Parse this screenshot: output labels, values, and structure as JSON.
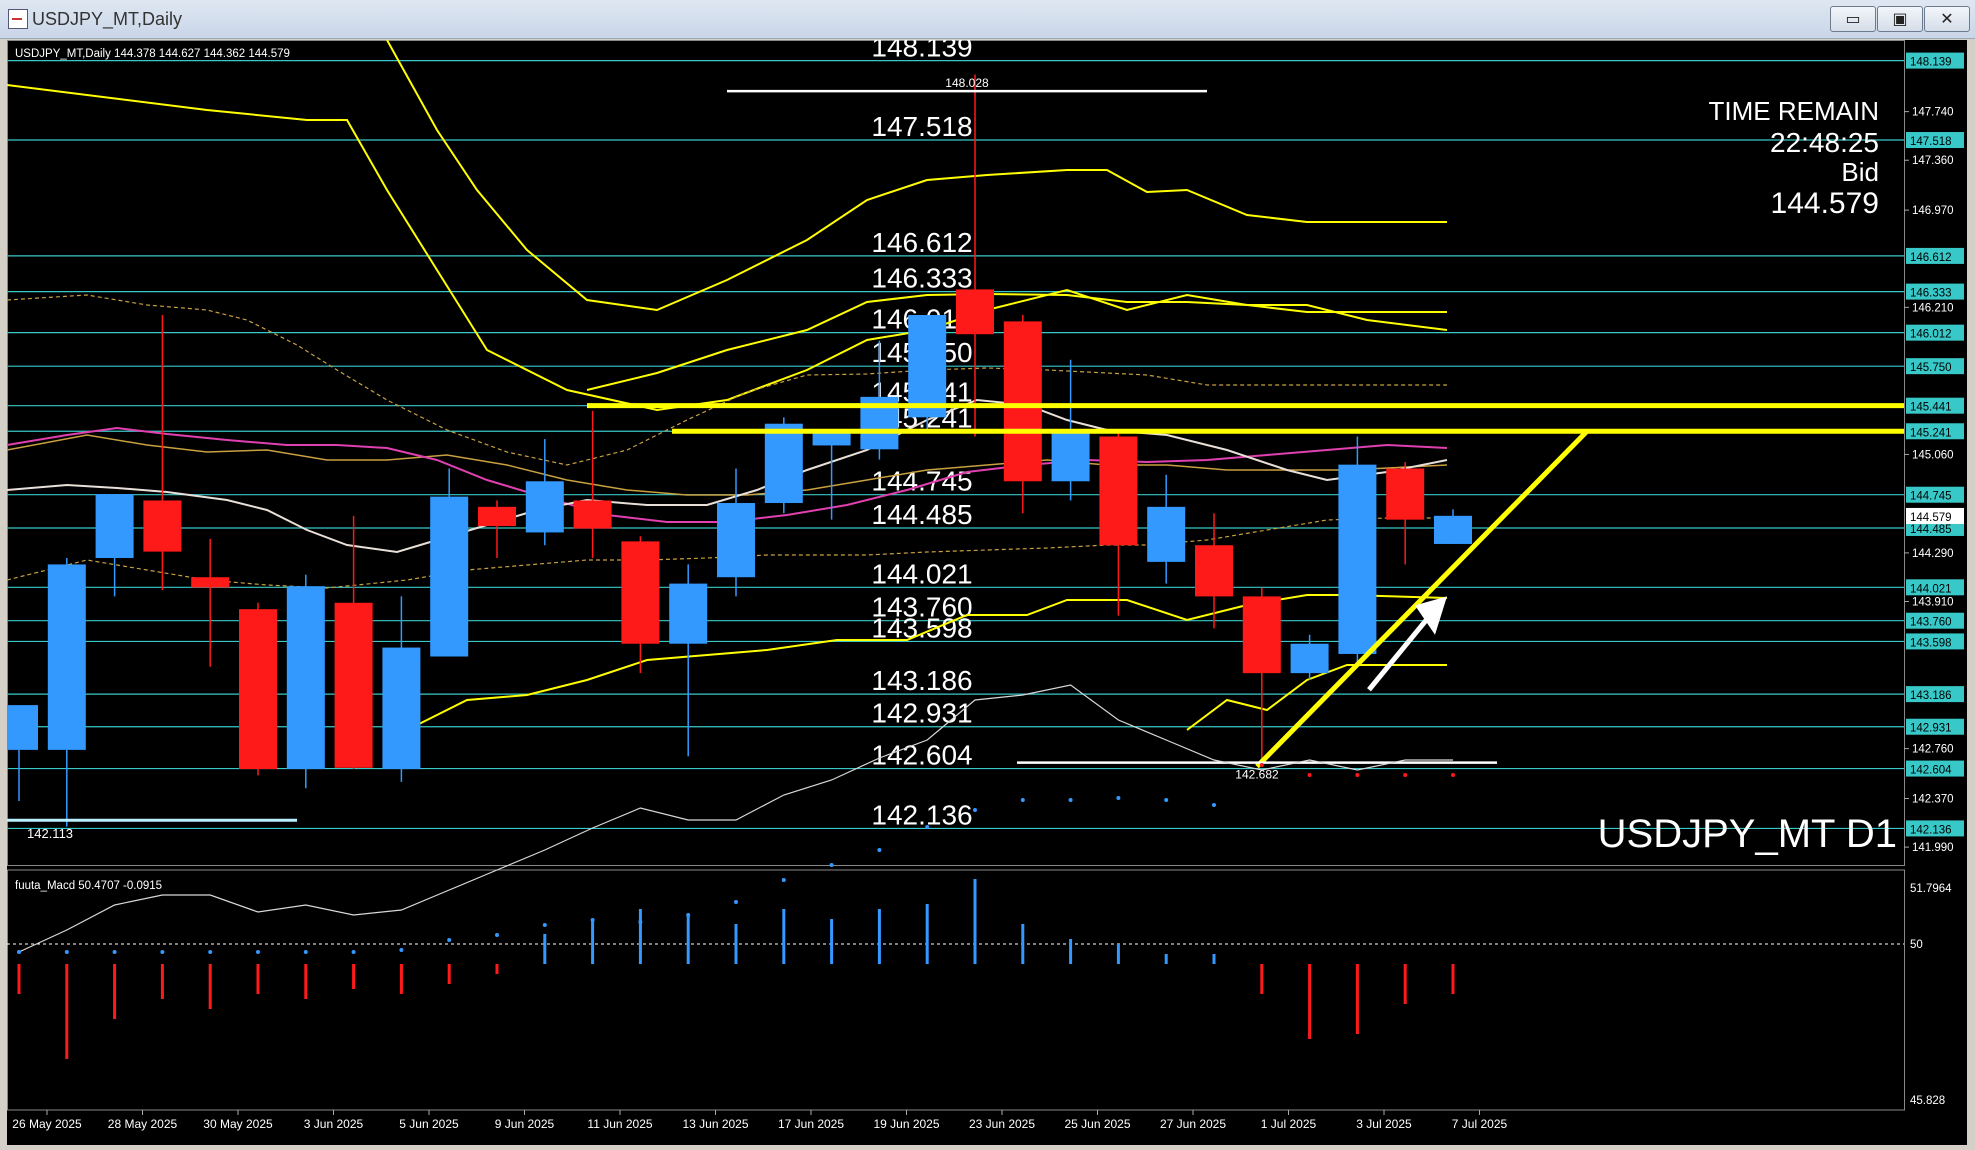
{
  "window": {
    "title": "USDJPY_MT,Daily",
    "buttons": [
      "▭",
      "▣",
      "✕"
    ]
  },
  "header": {
    "symbol_line": "USDJPY_MT,Daily  144.378 144.627 144.362 144.579",
    "macd_line": "fuuta_Macd 50.4707  -0.0915"
  },
  "info": {
    "time_remain_label": "TIME REMAIN",
    "time_remain": "22:48:25",
    "bid_label": "Bid",
    "bid": "144.579",
    "watermark": "USDJPY_MT D1"
  },
  "chart_data": {
    "type": "candlestick",
    "price_axis": {
      "range": [
        141.85,
        148.3
      ],
      "ticks": [
        "147.740",
        "147.360",
        "146.970",
        "146.210",
        "145.060",
        "144.290",
        "143.910",
        "142.760",
        "142.370",
        "141.990"
      ]
    },
    "level_lines": [
      "148.139",
      "147.518",
      "146.612",
      "146.333",
      "146.012",
      "145.750",
      "145.441",
      "145.241",
      "144.745",
      "144.485",
      "144.021",
      "143.760",
      "143.598",
      "143.186",
      "142.931",
      "142.604",
      "142.136"
    ],
    "bid_tag": "144.579",
    "annotations": {
      "high_label": "148.028",
      "low_label": "142.682",
      "left_low_label": "142.113"
    },
    "x_labels": [
      "26 May 2025",
      "28 May 2025",
      "30 May 2025",
      "3 Jun 2025",
      "5 Jun 2025",
      "9 Jun 2025",
      "11 Jun 2025",
      "13 Jun 2025",
      "17 Jun 2025",
      "19 Jun 2025",
      "23 Jun 2025",
      "25 Jun 2025",
      "27 Jun 2025",
      "1 Jul 2025",
      "3 Jul 2025",
      "7 Jul 2025"
    ],
    "candles": [
      {
        "o": 142.75,
        "h": 143.05,
        "l": 142.35,
        "c": 143.1
      },
      {
        "o": 142.75,
        "h": 144.25,
        "l": 142.15,
        "c": 144.2
      },
      {
        "o": 144.25,
        "h": 144.65,
        "l": 143.95,
        "c": 144.75
      },
      {
        "o": 144.7,
        "h": 146.15,
        "l": 144.0,
        "c": 144.3
      },
      {
        "o": 144.1,
        "h": 144.4,
        "l": 143.4,
        "c": 144.02
      },
      {
        "o": 143.85,
        "h": 143.9,
        "l": 142.55,
        "c": 142.6
      },
      {
        "o": 142.6,
        "h": 144.12,
        "l": 142.45,
        "c": 144.03
      },
      {
        "o": 143.9,
        "h": 144.58,
        "l": 142.6,
        "c": 142.61
      },
      {
        "o": 142.6,
        "h": 143.95,
        "l": 142.5,
        "c": 143.55
      },
      {
        "o": 143.48,
        "h": 144.95,
        "l": 143.48,
        "c": 144.73
      },
      {
        "o": 144.65,
        "h": 144.7,
        "l": 144.25,
        "c": 144.5
      },
      {
        "o": 144.45,
        "h": 145.18,
        "l": 144.35,
        "c": 144.85
      },
      {
        "o": 144.7,
        "h": 145.4,
        "l": 144.25,
        "c": 144.48
      },
      {
        "o": 144.38,
        "h": 144.42,
        "l": 143.35,
        "c": 143.58
      },
      {
        "o": 143.58,
        "h": 144.2,
        "l": 142.7,
        "c": 144.05
      },
      {
        "o": 144.1,
        "h": 144.95,
        "l": 143.95,
        "c": 144.68
      },
      {
        "o": 144.68,
        "h": 145.35,
        "l": 144.6,
        "c": 145.3
      },
      {
        "o": 145.13,
        "h": 145.25,
        "l": 144.55,
        "c": 145.23
      },
      {
        "o": 145.1,
        "h": 145.95,
        "l": 145.02,
        "c": 145.51
      },
      {
        "o": 145.35,
        "h": 146.05,
        "l": 145.25,
        "c": 146.15
      },
      {
        "o": 146.35,
        "h": 148.03,
        "l": 145.2,
        "c": 146.0
      },
      {
        "o": 146.1,
        "h": 146.15,
        "l": 144.6,
        "c": 144.85
      },
      {
        "o": 144.85,
        "h": 145.8,
        "l": 144.7,
        "c": 145.25
      },
      {
        "o": 145.2,
        "h": 145.25,
        "l": 143.8,
        "c": 144.35
      },
      {
        "o": 144.22,
        "h": 144.9,
        "l": 144.05,
        "c": 144.65
      },
      {
        "o": 144.35,
        "h": 144.6,
        "l": 143.7,
        "c": 143.95
      },
      {
        "o": 143.95,
        "h": 144.02,
        "l": 142.68,
        "c": 143.35
      },
      {
        "o": 143.35,
        "h": 143.65,
        "l": 143.3,
        "c": 143.58
      },
      {
        "o": 143.5,
        "h": 145.2,
        "l": 143.4,
        "c": 144.98
      },
      {
        "o": 144.95,
        "h": 145.0,
        "l": 144.2,
        "c": 144.55
      },
      {
        "o": 144.36,
        "h": 144.63,
        "l": 144.36,
        "c": 144.58
      }
    ],
    "macd_axis": {
      "ticks": [
        "51.7964",
        "50",
        "45.828"
      ]
    }
  },
  "colors": {
    "bull": "#3399ff",
    "bear": "#ff1a1a",
    "level": "#38c8c8",
    "yellow": "#ffff00",
    "ma_white": "#e8e0d8",
    "ma_magenta": "#e040b0",
    "ma_tan": "#c8a040"
  }
}
